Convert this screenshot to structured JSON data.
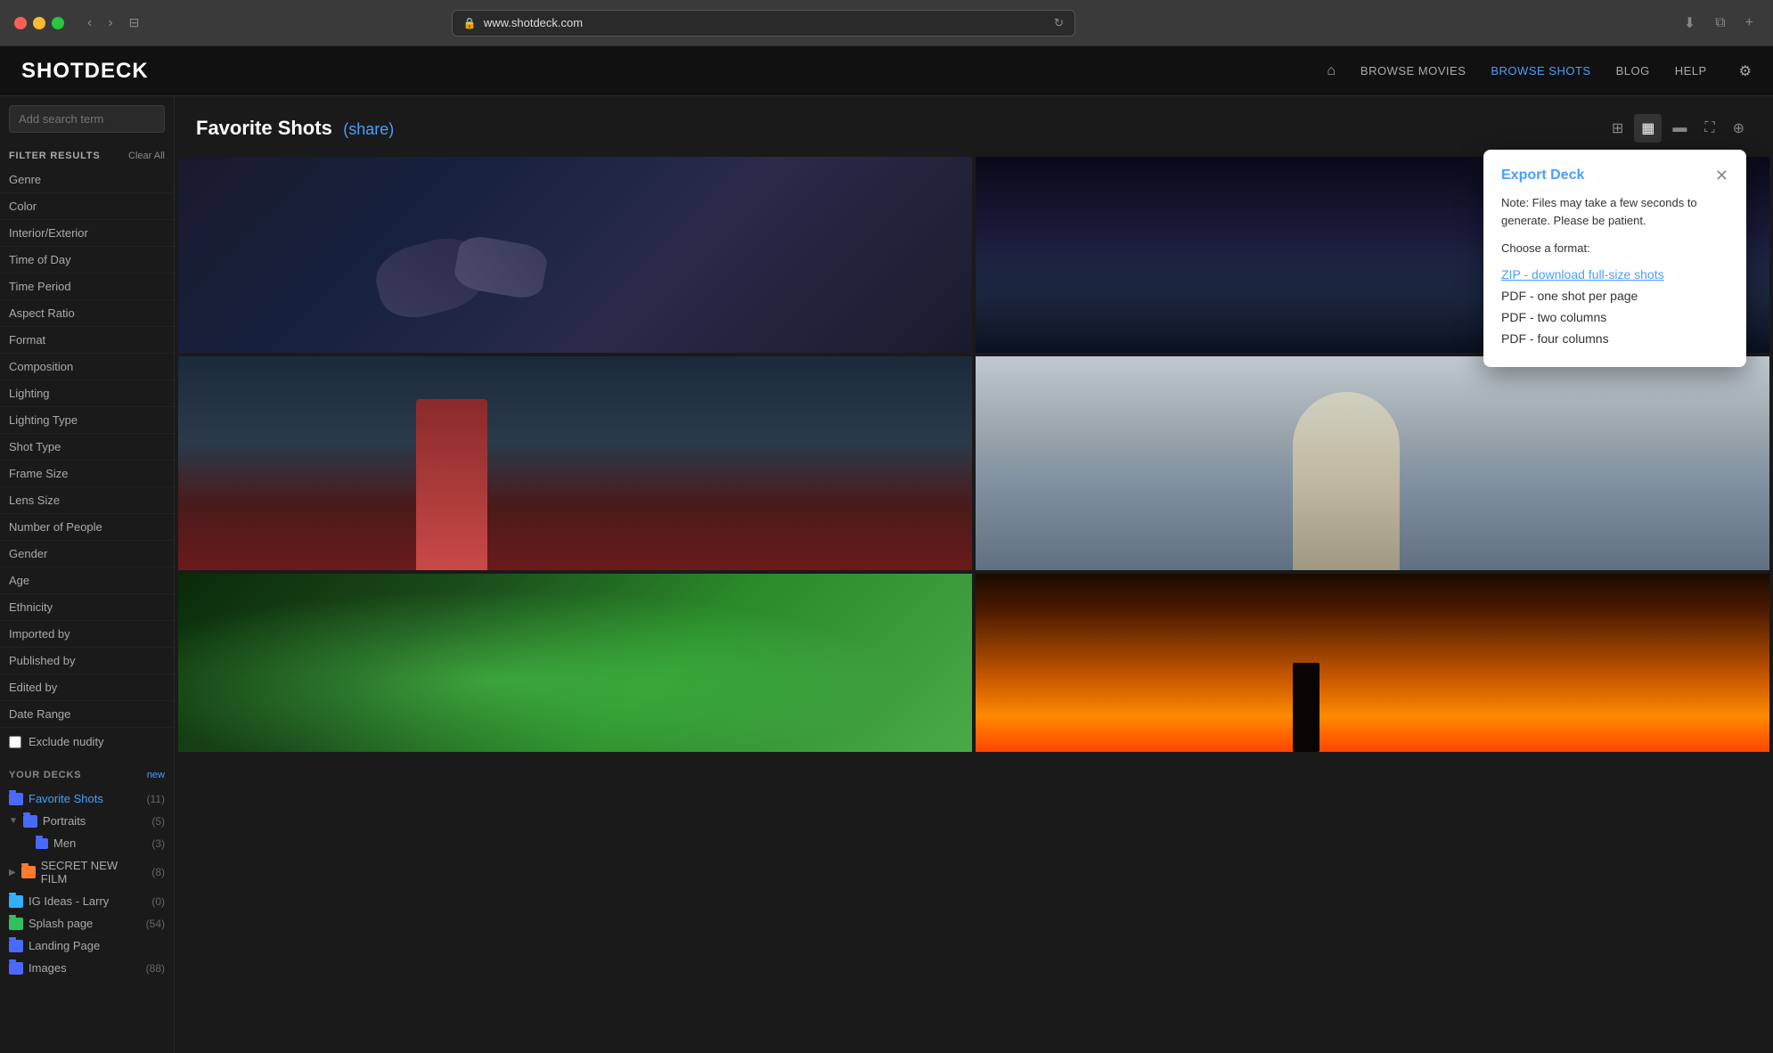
{
  "browser": {
    "url": "www.shotdeck.com",
    "back_btn": "‹",
    "forward_btn": "›"
  },
  "app": {
    "logo": "SHOTDECK",
    "nav": {
      "home_icon": "⌂",
      "browse_movies": "BROWSE MOVIES",
      "browse_shots": "BROWSE SHOTS",
      "blog": "BLOG",
      "help": "HELP",
      "settings_icon": "⚙"
    }
  },
  "sidebar": {
    "search_placeholder": "Add search term",
    "filter_results_label": "FILTER RESULTS",
    "clear_all_label": "Clear All",
    "filter_items": [
      "Genre",
      "Color",
      "Interior/Exterior",
      "Time of Day",
      "Time Period",
      "Aspect Ratio",
      "Format",
      "Composition",
      "Lighting",
      "Lighting Type",
      "Shot Type",
      "Frame Size",
      "Lens Size",
      "Number of People",
      "Gender",
      "Age",
      "Ethnicity",
      "Imported by",
      "Published by",
      "Edited by",
      "Date Range"
    ],
    "exclude_nudity_label": "Exclude nudity",
    "your_decks_label": "YOUR DECKS",
    "new_label": "new",
    "decks": [
      {
        "name": "Favorite Shots",
        "count": 11,
        "active": true,
        "color": "blue"
      },
      {
        "name": "Portraits",
        "count": 5,
        "expanded": true,
        "color": "blue"
      },
      {
        "name": "Men",
        "count": 3,
        "sub": true,
        "color": "blue"
      },
      {
        "name": "SECRET NEW FILM",
        "count": 8,
        "color": "orange"
      },
      {
        "name": "IG Ideas - Larry",
        "count": 0,
        "color": "teal"
      },
      {
        "name": "Splash page",
        "count": 54,
        "color": "green"
      },
      {
        "name": "Landing Page",
        "color": "blue"
      },
      {
        "name": "Images",
        "count": 88,
        "color": "blue"
      }
    ]
  },
  "content": {
    "page_title": "Favorite Shots",
    "share_label": "(share)",
    "view_controls": {
      "grid3_icon": "⊞",
      "grid2_icon": "▦",
      "single_icon": "▬",
      "fullscreen_icon": "⛶",
      "export_icon": "⊕"
    }
  },
  "export_modal": {
    "title": "Export Deck",
    "close_icon": "✕",
    "note": "Note: Files may take a few seconds to\ngenerate. Please be patient.",
    "choose_format_label": "Choose a format:",
    "options": [
      {
        "label": "ZIP - download full-size shots",
        "style": "link"
      },
      {
        "label": "PDF - one shot per page",
        "style": "normal"
      },
      {
        "label": "PDF - two columns",
        "style": "normal"
      },
      {
        "label": "PDF - four columns",
        "style": "normal"
      }
    ]
  }
}
